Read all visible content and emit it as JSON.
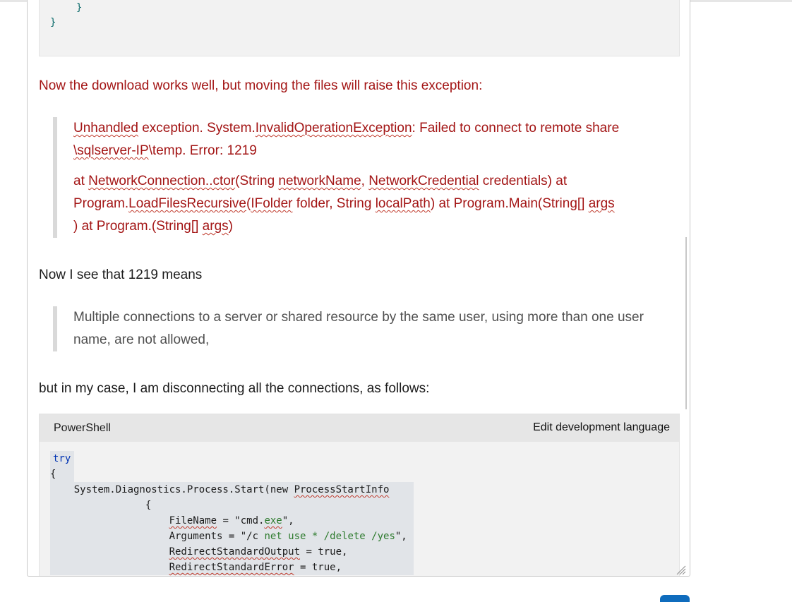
{
  "code_top": {
    "line1": "}",
    "line2": "}"
  },
  "para1": "Now the download works well, but moving the files will raise this exception:",
  "error_quote": {
    "p1_w1": "Unhandled",
    "p1_w2": " exception. System.",
    "p1_w3": "InvalidOperationException",
    "p1_w4": ": Failed to connect to remote share ",
    "p1_w5": "\\sqlserver-IP",
    "p1_w6": "\\temp. Error: 1219",
    "p2_a": "at ",
    "p2_b": "NetworkConnection..ctor",
    "p2_c": "(String ",
    "p2_d": "networkName",
    "p2_e": ", ",
    "p2_f": "NetworkCredential",
    "p2_g": " credentials) at Program.",
    "p2_h": "LoadFilesRecursive",
    "p2_i": "(",
    "p2_j": "IFolder",
    "p2_k": " folder, String ",
    "p2_l": "localPath",
    "p2_m": ") at Program.Main(String[] ",
    "p2_n": "args",
    "p2_o": ") at Program.(String[] ",
    "p2_p": "args",
    "p2_q": ")"
  },
  "para2": "Now I see that 1219 means",
  "meaning_quote": "Multiple connections to a server or shared resource by the same user, using more than one user name, are not allowed,",
  "para3": "but in my case, I am disconnecting all the connections, as follows:",
  "codeblock": {
    "language": "PowerShell",
    "edit_label": "Edit development language",
    "l1": "try",
    "l2": "{",
    "l3_a": "    System.Diagnostics.Process.Start(new ",
    "l3_b": "ProcessStartInfo",
    "l4": "                {",
    "l5_a": "                    ",
    "l5_b": "FileName",
    "l5_c": " = \"cmd.",
    "l5_d": "exe",
    "l5_e": "\",",
    "l6_a": "                    Arguments = \"/c ",
    "l6_b": "net use * /delete /yes",
    "l6_c": "\",",
    "l7_a": "                    ",
    "l7_b": "RedirectStandardOutput",
    "l7_c": " = true,",
    "l8_a": "                    ",
    "l8_b": "RedirectStandardError",
    "l8_c": " = true,"
  },
  "colors": {
    "error_text": "#a31515",
    "accent": "#0f6cbd"
  }
}
